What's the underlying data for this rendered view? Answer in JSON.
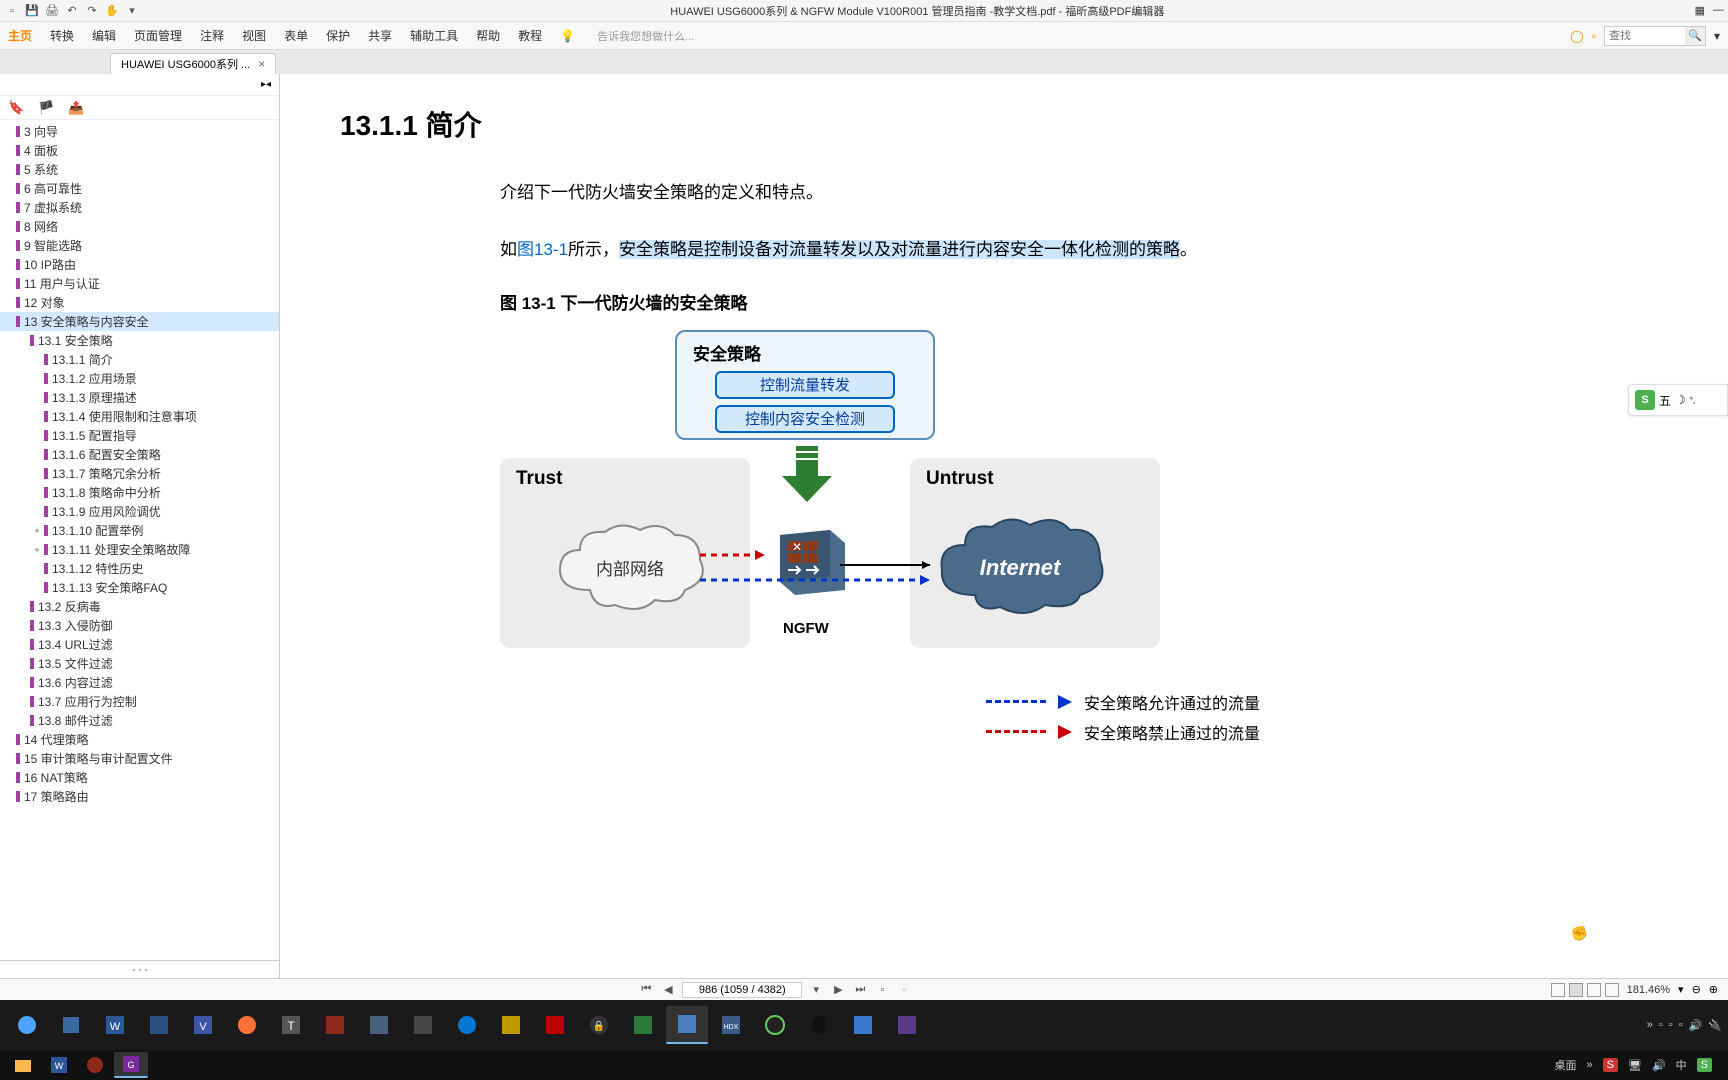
{
  "titlebar": {
    "title": "HUAWEI USG6000系列 & NGFW Module V100R001 管理员指南 -教学文档.pdf - 福昕高级PDF编辑器"
  },
  "menubar": {
    "items": [
      "主页",
      "转换",
      "编辑",
      "页面管理",
      "注释",
      "视图",
      "表单",
      "保护",
      "共享",
      "辅助工具",
      "帮助",
      "教程"
    ],
    "hint": "告诉我您想做什么...",
    "search_placeholder": "查找"
  },
  "tab": {
    "label": "HUAWEI USG6000系列 ..."
  },
  "tree": {
    "items": [
      {
        "lvl": 1,
        "label": "3 向导"
      },
      {
        "lvl": 1,
        "label": "4 面板"
      },
      {
        "lvl": 1,
        "label": "5 系统"
      },
      {
        "lvl": 1,
        "label": "6 高可靠性"
      },
      {
        "lvl": 1,
        "label": "7 虚拟系统"
      },
      {
        "lvl": 1,
        "label": "8 网络"
      },
      {
        "lvl": 1,
        "label": "9 智能选路"
      },
      {
        "lvl": 1,
        "label": "10 IP路由"
      },
      {
        "lvl": 1,
        "label": "11 用户与认证"
      },
      {
        "lvl": 1,
        "label": "12 对象"
      },
      {
        "lvl": 1,
        "label": "13 安全策略与内容安全",
        "selected": true
      },
      {
        "lvl": 2,
        "label": "13.1 安全策略"
      },
      {
        "lvl": 3,
        "label": "13.1.1 简介"
      },
      {
        "lvl": 3,
        "label": "13.1.2 应用场景"
      },
      {
        "lvl": 3,
        "label": "13.1.3 原理描述"
      },
      {
        "lvl": 3,
        "label": "13.1.4 使用限制和注意事项"
      },
      {
        "lvl": 3,
        "label": "13.1.5 配置指导"
      },
      {
        "lvl": 3,
        "label": "13.1.6 配置安全策略"
      },
      {
        "lvl": 3,
        "label": "13.1.7 策略冗余分析"
      },
      {
        "lvl": 3,
        "label": "13.1.8 策略命中分析"
      },
      {
        "lvl": 3,
        "label": "13.1.9 应用风险调优"
      },
      {
        "lvl": 3,
        "label": "13.1.10 配置举例",
        "exp": "+"
      },
      {
        "lvl": 3,
        "label": "13.1.11 处理安全策略故障",
        "exp": "+"
      },
      {
        "lvl": 3,
        "label": "13.1.12 特性历史"
      },
      {
        "lvl": 3,
        "label": "13.1.13 安全策略FAQ"
      },
      {
        "lvl": 2,
        "label": "13.2 反病毒"
      },
      {
        "lvl": 2,
        "label": "13.3 入侵防御"
      },
      {
        "lvl": 2,
        "label": "13.4 URL过滤"
      },
      {
        "lvl": 2,
        "label": "13.5 文件过滤"
      },
      {
        "lvl": 2,
        "label": "13.6 内容过滤"
      },
      {
        "lvl": 2,
        "label": "13.7 应用行为控制"
      },
      {
        "lvl": 2,
        "label": "13.8 邮件过滤"
      },
      {
        "lvl": 1,
        "label": "14 代理策略"
      },
      {
        "lvl": 1,
        "label": "15 审计策略与审计配置文件"
      },
      {
        "lvl": 1,
        "label": "16 NAT策略"
      },
      {
        "lvl": 1,
        "label": "17 策略路由"
      }
    ]
  },
  "doc": {
    "heading": "13.1.1 简介",
    "p1": "介绍下一代防火墙安全策略的定义和特点。",
    "p2_a": "如",
    "p2_link": "图13-1",
    "p2_b": "所示，",
    "p2_hl": "安全策略是控制设备对流量转发以及对流量进行内容安全一体化检测的策略",
    "p2_end": "。",
    "figcap": "图 13-1 下一代防火墙的安全策略",
    "policy_title": "安全策略",
    "btn1": "控制流量转发",
    "btn2": "控制内容安全检测",
    "trust": "Trust",
    "untrust": "Untrust",
    "inner": "内部网络",
    "internet": "Internet",
    "ngfw": "NGFW",
    "legend_allow": "安全策略允许通过的流量",
    "legend_deny": "安全策略禁止通过的流量"
  },
  "ime": {
    "label": "五"
  },
  "footer": {
    "page_info": "986 (1059 / 4382)",
    "zoom": "181.46%"
  },
  "taskbar": {
    "desktop": "桌面",
    "lang": "中"
  }
}
